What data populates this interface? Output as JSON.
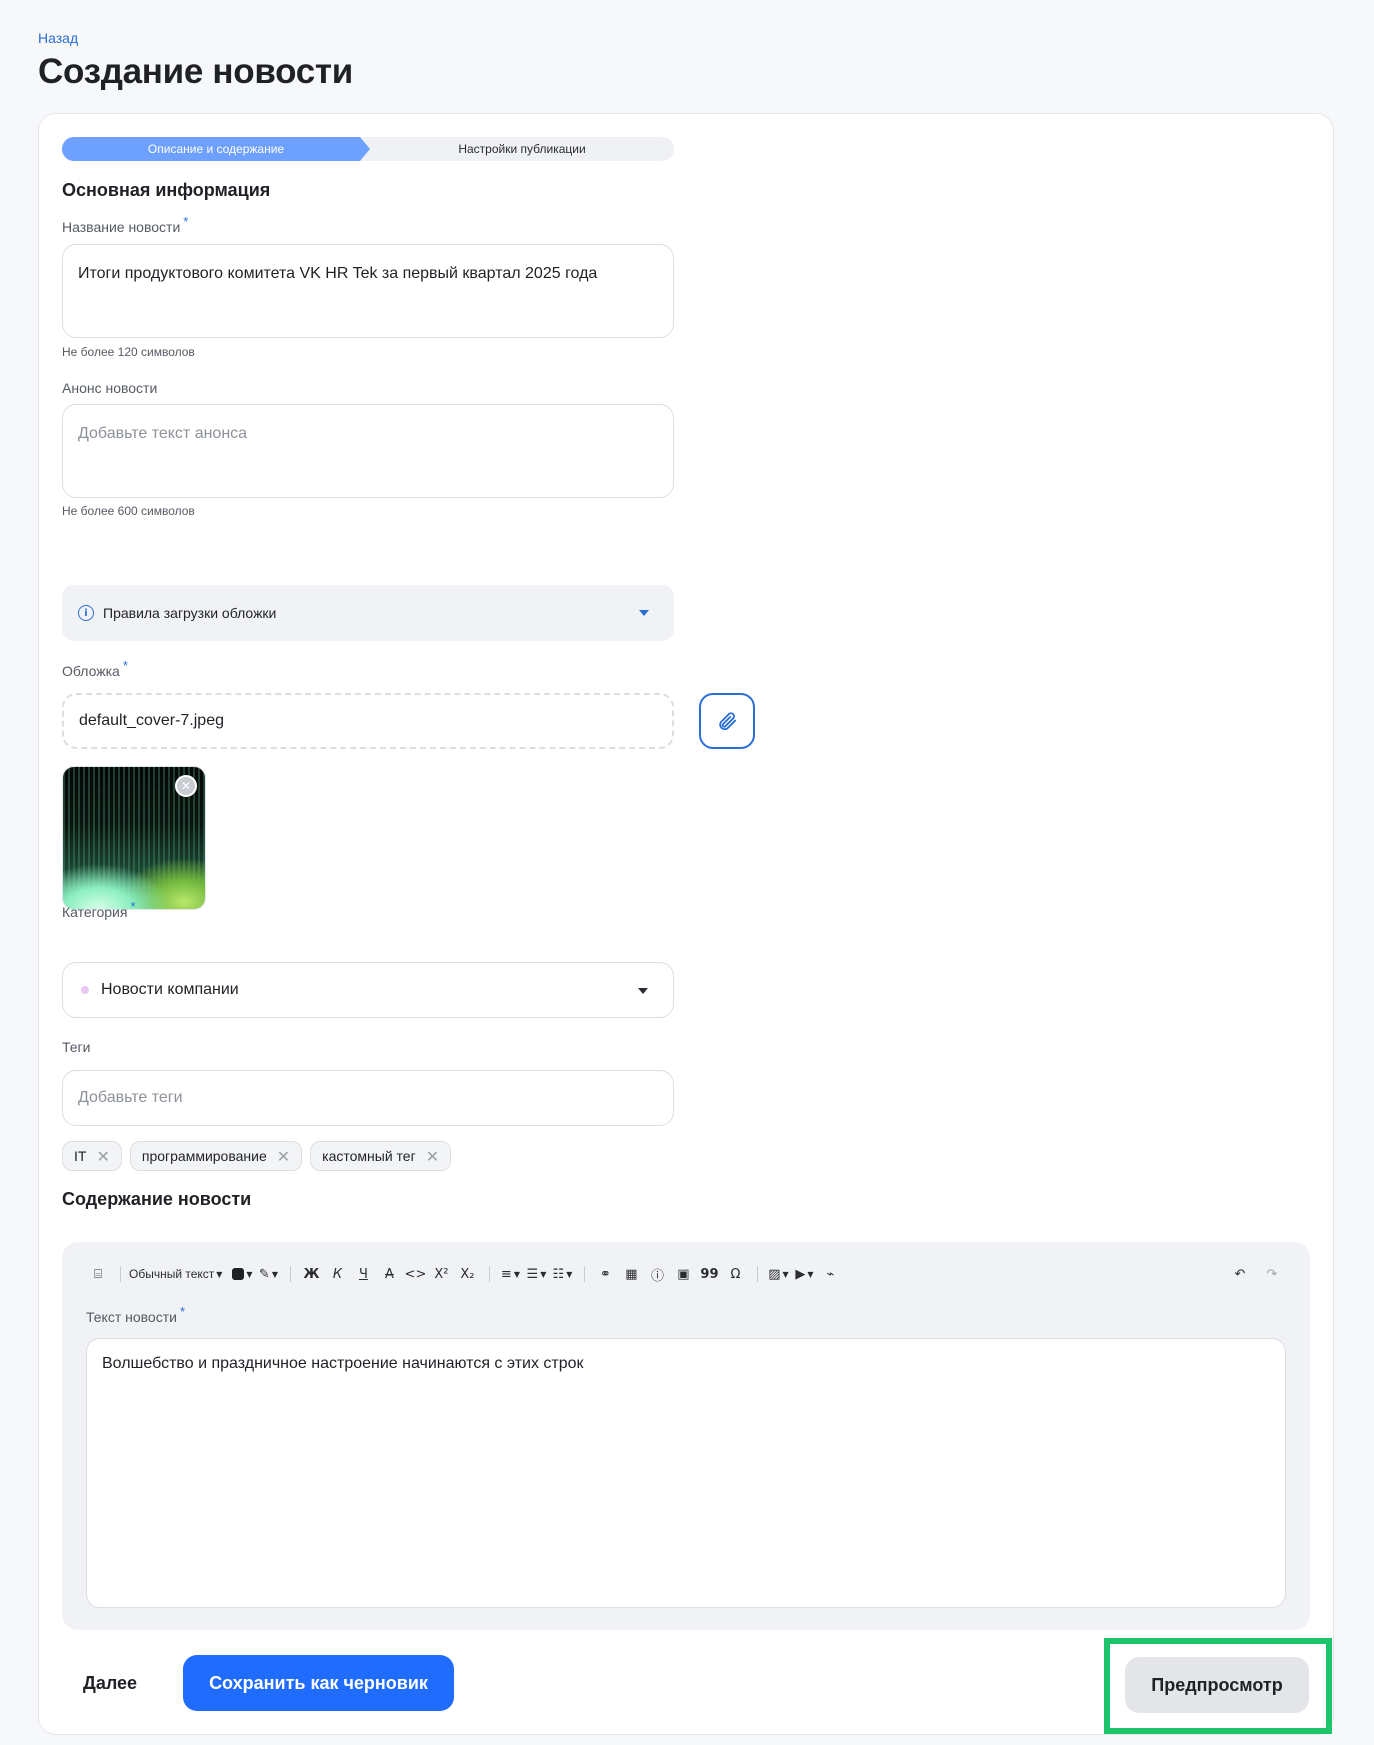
{
  "nav": {
    "back_label": "Назад"
  },
  "page": {
    "title": "Создание новости"
  },
  "stepper": {
    "steps": [
      {
        "label": "Описание и содержание",
        "active": true
      },
      {
        "label": "Настройки публикации",
        "active": false
      }
    ]
  },
  "basic_info": {
    "section_title": "Основная информация",
    "title_field": {
      "label": "Название новости",
      "required_mark": "*",
      "value": "Итоги продуктового комитета VK HR Tek за первый квартал 2025 года",
      "hint": "Не более 120 символов"
    },
    "announce_field": {
      "label": "Анонс новости",
      "placeholder": "Добавьте текст анонса",
      "hint": "Не более 600 символов"
    },
    "cover_rules": {
      "label": "Правила загрузки обложки",
      "icon": "info-icon"
    },
    "cover_field": {
      "label": "Обложка",
      "required_mark": "*",
      "file_name": "default_cover-7.jpeg",
      "attach_icon": "paperclip-icon"
    },
    "category_field": {
      "label": "Категория",
      "required_mark": "*",
      "value": "Новости компании"
    },
    "tags_field": {
      "label": "Теги",
      "placeholder": "Добавьте теги",
      "tags": [
        "IT",
        "программирование",
        "кастомный тег"
      ]
    }
  },
  "content": {
    "section_title": "Содержание новости",
    "toolbar": {
      "text_style": "Обычный текст",
      "bold": "Ж",
      "italic": "К",
      "underline": "Ч",
      "strike": "A",
      "code": "<>",
      "superscript": "X²",
      "subscript": "X₂",
      "quote": "99",
      "omega": "Ω"
    },
    "text_label": "Текст новости",
    "required_mark": "*",
    "text_value": "Волшебство и праздничное настроение начинаются с этих строк"
  },
  "actions": {
    "next_label": "Далее",
    "draft_label": "Сохранить как черновик",
    "preview_label": "Предпросмотр"
  },
  "colors": {
    "accent": "#1f6cff",
    "step_active": "#6ea1ff",
    "highlight": "#1ec46a"
  }
}
